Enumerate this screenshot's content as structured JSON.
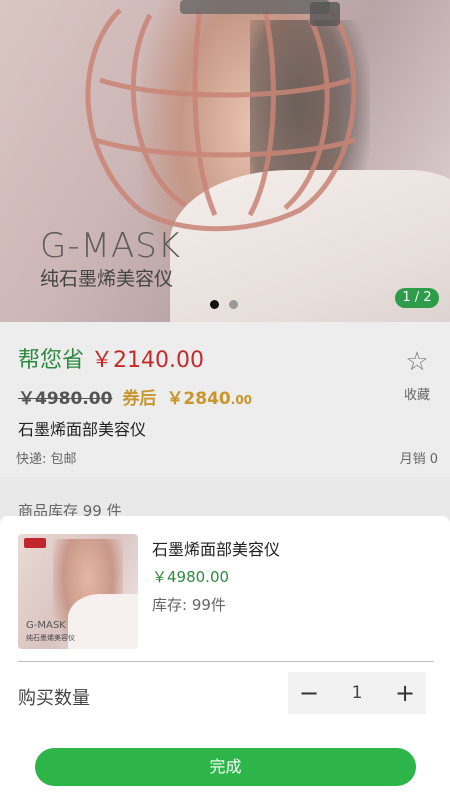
{
  "hero": {
    "brand": "G-MASK",
    "subtitle": "纯石墨烯美容仪",
    "pager": "1 / 2"
  },
  "info": {
    "save_label": "帮您省",
    "save_amount": "￥2140.00",
    "original_price": "￥4980.00",
    "coupon_label": "券后",
    "after_price_main": "￥2840",
    "after_price_cents": ".00",
    "title": "石墨烯面部美容仪",
    "shipping": "快递: 包邮",
    "sold": "月销 0",
    "favorite_label": "收藏",
    "stock_line": "商品库存   99 件"
  },
  "sheet": {
    "title": "石墨烯面部美容仪",
    "price": "￥4980.00",
    "stock": "库存:  99件",
    "qty_label": "购买数量",
    "qty_value": "1",
    "minus": "−",
    "plus": "+",
    "done_label": "完成",
    "thumb_brand": "G-MASK",
    "thumb_sub": "纯石墨烯美容仪"
  },
  "colors": {
    "green": "#2eb54a",
    "price_red": "#c42a2a",
    "coupon_gold": "#c8962c"
  },
  "icons": {
    "favorite": "star-outline-icon",
    "minus": "minus-icon",
    "plus": "plus-icon"
  }
}
